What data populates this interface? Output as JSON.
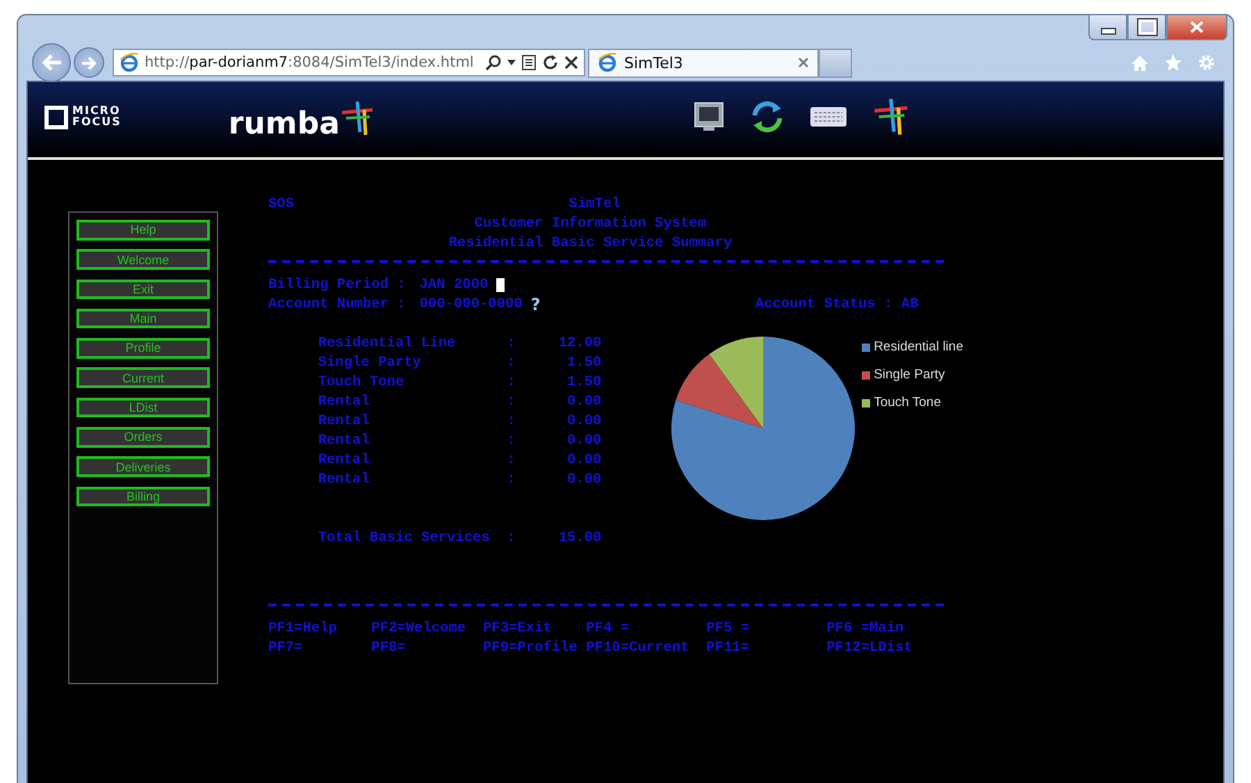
{
  "browser": {
    "url": "http://**par-dorianm7**:8084/SimTel3/index.html",
    "tabs": [
      {
        "title": "SimTel3",
        "selected": true
      }
    ]
  },
  "header": {
    "vendor_logo": [
      "MICRO",
      "FOCUS"
    ],
    "product_logo": "rumba"
  },
  "menu": [
    {
      "label": "Help"
    },
    {
      "label": "Welcome"
    },
    {
      "label": "Exit"
    },
    {
      "label": "Main"
    },
    {
      "label": "Profile"
    },
    {
      "label": "Current"
    },
    {
      "label": "LDist"
    },
    {
      "label": "Orders"
    },
    {
      "label": "Deliveries"
    },
    {
      "label": "Billing"
    }
  ],
  "screen": {
    "system": "SOS",
    "title": "SimTel",
    "subtitle": "Customer Information System",
    "heading": "Residential Basic Service Summary",
    "billing_period": {
      "label": "Billing Period :",
      "value": "JAN 2000"
    },
    "account_number": {
      "label": "Account Number :",
      "value": "000-000-0000",
      "help": "?"
    },
    "account_status": {
      "label": "Account Status :",
      "value": "AB"
    },
    "charges": [
      {
        "name": "Residential Line",
        "sep": ":",
        "amount": "12.00"
      },
      {
        "name": "Single Party",
        "sep": ":",
        "amount": "1.50"
      },
      {
        "name": "Touch Tone",
        "sep": ":",
        "amount": "1.50"
      },
      {
        "name": "Rental",
        "sep": ":",
        "amount": "0.00"
      },
      {
        "name": "Rental",
        "sep": ":",
        "amount": "0.00"
      },
      {
        "name": "Rental",
        "sep": ":",
        "amount": "0.00"
      },
      {
        "name": "Rental",
        "sep": ":",
        "amount": "0.00"
      },
      {
        "name": "Rental",
        "sep": ":",
        "amount": "0.00"
      }
    ],
    "total": {
      "name": "Total Basic Services",
      "sep": ":",
      "amount": "15.00"
    },
    "chart_data": {
      "type": "pie",
      "categories": [
        "Residential line",
        "Single Party",
        "Touch Tone"
      ],
      "values": [
        80,
        10,
        10
      ],
      "legend": "right",
      "colors": [
        "#4f81bd",
        "#c0504d",
        "#9bbb59"
      ]
    },
    "function_keys": [
      [
        "PF1=Help",
        "PF2=Welcome",
        "PF3=Exit",
        "PF4 =",
        "PF5 =",
        "PF6 =Main"
      ],
      [
        "PF7=",
        "PF8=",
        "PF9=Profile",
        "PF10=Current",
        "PF11=",
        "PF12=LDist"
      ]
    ]
  }
}
